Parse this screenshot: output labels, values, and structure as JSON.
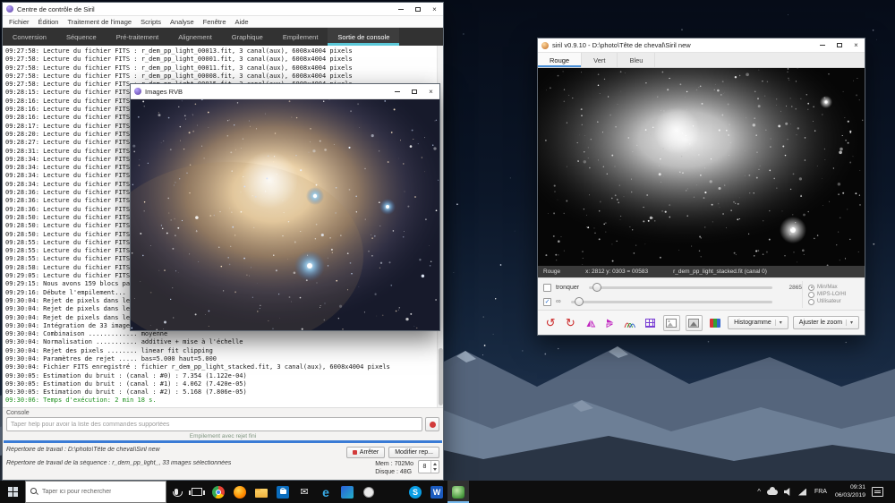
{
  "colors": {
    "tab_accent": "#5bc8d8",
    "progress_blue": "#3a7bd5",
    "log_green": "#1d8f1d",
    "taskbar_accent": "#76b9ed"
  },
  "icons": {
    "undo": "↺",
    "redo": "↻",
    "check": "✓",
    "link": "∞",
    "close": "×",
    "caret_down": "▾",
    "tray_caret": "^"
  },
  "control_window": {
    "title": "Centre de contrôle de Siril",
    "menu": [
      "Fichier",
      "Édition",
      "Traitement de l'image",
      "Scripts",
      "Analyse",
      "Fenêtre",
      "Aide"
    ],
    "tabs": [
      {
        "label": "Conversion"
      },
      {
        "label": "Séquence"
      },
      {
        "label": "Pré-traitement"
      },
      {
        "label": "Alignement"
      },
      {
        "label": "Graphique"
      },
      {
        "label": "Empilement"
      },
      {
        "label": "Sortie de console",
        "active": true
      }
    ],
    "log_lines": [
      {
        "text": "09:27:58: Lecture du fichier FITS : r_dem_pp_light_00013.fit, 3 canal(aux), 6008x4004 pixels"
      },
      {
        "text": "09:27:58: Lecture du fichier FITS : r_dem_pp_light_00001.fit, 3 canal(aux), 6008x4004 pixels"
      },
      {
        "text": "09:27:58: Lecture du fichier FITS : r_dem_pp_light_00011.fit, 3 canal(aux), 6008x4004 pixels"
      },
      {
        "text": "09:27:58: Lecture du fichier FITS : r_dem_pp_light_00008.fit, 3 canal(aux), 6008x4004 pixels"
      },
      {
        "text": "09:27:58: Lecture du fichier FITS : r_dem_pp_light_00015.fit, 3 canal(aux), 6008x4004 pixels"
      },
      {
        "text": "09:28:15: Lecture du fichier FITS : r_dem_pp_light_00002.fit, 3 canal(aux), 6008x4004 pixels"
      },
      {
        "text": "09:28:16: Lecture du fichier FITS : r_dem_pp_light_00003.fit, 3 canal(aux), 6008x4004 pixels"
      },
      {
        "text": "09:28:16: Lecture du fichier FITS : r_dem_pp_light_00004.fit, 3 canal(aux), 6008x4004 pixels"
      },
      {
        "text": "09:28:16: Lecture du fichier FITS : r_dem_pp_light_00005.fit, 3 canal(aux), 6008x4004 pixels"
      },
      {
        "text": "09:28:17: Lecture du fichier FITS : r_dem_pp_light_00006.fit, 3 canal(aux), 6008x4004 pixels"
      },
      {
        "text": "09:28:20: Lecture du fichier FITS : r_dem_pp_light_00007.fit, 3 canal(aux), 6008x4004 pixels"
      },
      {
        "text": "09:28:27: Lecture du fichier FITS : r_dem_pp_light_00009.fit, 3 canal(aux), 6008x4004 pixels"
      },
      {
        "text": "09:28:31: Lecture du fichier FITS : r_dem_pp_light_00010.fit, 3 canal(aux), 6008x4004 pixels"
      },
      {
        "text": "09:28:34: Lecture du fichier FITS : r_dem_pp_light_00012.fit, 3 canal(aux), 6008x4004 pixels"
      },
      {
        "text": "09:28:34: Lecture du fichier FITS : r_dem_pp_light_00014.fit, 3 canal(aux), 6008x4004 pixels"
      },
      {
        "text": "09:28:34: Lecture du fichier FITS : r_dem_pp_light_00016.fit, 3 canal(aux), 6008x4004 pixels"
      },
      {
        "text": "09:28:34: Lecture du fichier FITS : r_dem_pp_light_00017.fit, 3 canal(aux), 6008x4004 pixels"
      },
      {
        "text": "09:28:36: Lecture du fichier FITS : r_dem_pp_light_00018.fit, 3 canal(aux), 6008x4004 pixels"
      },
      {
        "text": "09:28:36: Lecture du fichier FITS : r_dem_pp_light_00019.fit, 3 canal(aux), 6008x4004 pixels"
      },
      {
        "text": "09:28:36: Lecture du fichier FITS : r_dem_pp_light_00020.fit, 3 canal(aux), 6008x4004 pixels"
      },
      {
        "text": "09:28:50: Lecture du fichier FITS : r_dem_pp_light_00021.fit, 3 canal(aux), 6008x4004 pixels"
      },
      {
        "text": "09:28:50: Lecture du fichier FITS : r_dem_pp_light_00022.fit, 3 canal(aux), 6008x4004 pixels"
      },
      {
        "text": "09:28:50: Lecture du fichier FITS : r_dem_pp_light_00023.fit, 3 canal(aux), 6008x4004 pixels"
      },
      {
        "text": "09:28:55: Lecture du fichier FITS : r_dem_pp_light_00024.fit, 3 canal(aux), 6008x4004 pixels"
      },
      {
        "text": "09:28:55: Lecture du fichier FITS : r_dem_pp_light_00025.fit, 3 canal(aux), 6008x4004 pixels"
      },
      {
        "text": "09:28:55: Lecture du fichier FITS : r_dem_pp_light_00026.fit, 3 canal(aux), 6008x4004 pixels"
      },
      {
        "text": "09:28:58: Lecture du fichier FITS : r_dem_pp_light_00027.fit, 3 canal(aux), 6008x4004 pixels"
      },
      {
        "text": "09:29:05: Lecture du fichier FITS : r_dem_pp_light_00028.fit, 3 canal(aux), 6008x4004 pixels"
      },
      {
        "text": "09:29:15: Nous avons 159 blocs parallèles pour l'empilement"
      },
      {
        "text": "09:29:16: Débute l'empilement..."
      },
      {
        "text": "09:30:04: Rejet de pixels dans le canal #0"
      },
      {
        "text": "09:30:04: Rejet de pixels dans le canal #1"
      },
      {
        "text": "09:30:04: Rejet de pixels dans le canal #2"
      },
      {
        "text": "09:30:04: Intégration de 33 images :"
      },
      {
        "text": "09:30:04: Combinaison ............. moyenne"
      },
      {
        "text": "09:30:04: Normalisation ........... additive + mise à l'échelle"
      },
      {
        "text": "09:30:04: Rejet des pixels ........ linear fit clipping"
      },
      {
        "text": "09:30:04: Paramètres de rejet ..... bas=5.000 haut=5.000"
      },
      {
        "text": "09:30:04: Fichier FITS enregistré : fichier r_dem_pp_light_stacked.fit, 3 canal(aux), 6008x4004 pixels"
      },
      {
        "text": "09:30:05: Estimation du bruit : (canal : #0) : 7.354 (1.122e-04)"
      },
      {
        "text": "09:30:05: Estimation du bruit : (canal : #1) : 4.062 (7.420e-05)"
      },
      {
        "text": "09:30:05: Estimation du bruit : (canal : #2) : 5.168 (7.806e-05)"
      },
      {
        "text": "09:30:06: Temps d'exécution: 2 min 18 s.",
        "highlight": true
      }
    ],
    "console_label": "Console",
    "console_placeholder": "Taper help pour avoir la liste des commandes supportées",
    "status_hint": "Empilement avec rejet fini",
    "progress_percent": 100,
    "working_dir": "Répertoire de travail : D:\\photo\\Tête de cheval\\Siril new",
    "sequence_dir": "Répertoire de travail de la séquence : r_dem_pp_light_, 33 images sélectionnées",
    "stop_button": "Arrêter",
    "modify_button": "Modifier rep...",
    "mem_label": "Mem : 702Mo",
    "disk_label": "Disque : 48G",
    "thread_spinner": "8"
  },
  "rgb_window": {
    "title": "Images RVB"
  },
  "image_window": {
    "title": "siril v0.9.10 - D:\\photo\\Tête de cheval\\Siril new",
    "tabs": [
      "Rouge",
      "Vert",
      "Bleu"
    ],
    "status_channel": "Rouge",
    "status_coords": "x: 2812 y: 0303 = 00583",
    "status_file": "r_dem_pp_light_stacked.fit (canal 0)",
    "truncate_label": "tronquer",
    "hi_value": "2865",
    "radio_options": [
      "Min/Max",
      "MIPS-LO/HI",
      "Utilisateur"
    ],
    "histogram_dropdown": "Histogramme",
    "zoom_dropdown": "Ajuster le zoom"
  },
  "taskbar": {
    "search_placeholder": "Taper ici pour rechercher",
    "language": "FRA",
    "time": "09:31",
    "date": "06/03/2019",
    "apps": [
      {
        "name": "task-view",
        "style": "taskview"
      },
      {
        "name": "chrome",
        "style": "chrome"
      },
      {
        "name": "firefox",
        "style": "firefox"
      },
      {
        "name": "file-explorer",
        "style": "explorer"
      },
      {
        "name": "store",
        "style": "store"
      },
      {
        "name": "mail",
        "style": "mail",
        "glyph": "✉"
      },
      {
        "name": "edge",
        "style": "edge",
        "glyph": "e"
      },
      {
        "name": "photos",
        "style": "photos"
      },
      {
        "name": "photo-viewer",
        "style": "viewer"
      },
      {
        "name": "spacer",
        "style": "spacer"
      },
      {
        "name": "skype",
        "style": "skype",
        "glyph": "S"
      },
      {
        "name": "word",
        "style": "word",
        "glyph": "W"
      },
      {
        "name": "siril",
        "style": "siril",
        "active": true
      }
    ]
  }
}
